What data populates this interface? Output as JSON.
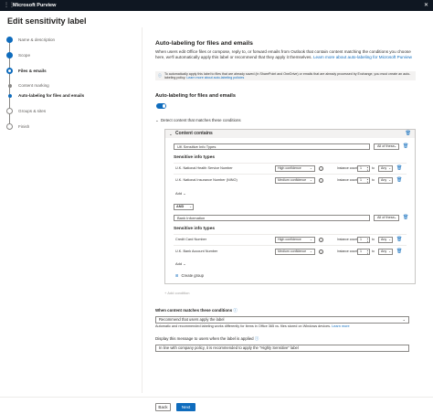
{
  "app": {
    "title": "Microsoft Purview",
    "menu_icon": "grid-dots-icon",
    "close_icon": "close-icon"
  },
  "page": {
    "title": "Edit sensitivity label"
  },
  "wizard": {
    "steps": [
      {
        "label": "Name & description",
        "state": "done"
      },
      {
        "label": "Scope",
        "state": "done"
      },
      {
        "label": "Files & emails",
        "state": "current"
      },
      {
        "label": "Content marking",
        "state": "sub"
      },
      {
        "label": "Auto-labeling for files and emails",
        "state": "sub-active"
      },
      {
        "label": "Groups & sites",
        "state": "pending"
      },
      {
        "label": "Finish",
        "state": "pending"
      }
    ]
  },
  "section": {
    "heading": "Auto-labeling for files and emails",
    "description": "When users edit Office files or compose, reply to, or forward emails from Outlook that contain content matching the conditions you choose here, we'll automatically apply this label or recommend that they apply it themselves.",
    "description_link": "Learn more about auto-labeling for Microsoft Purview",
    "info_text": "To automatically apply this label to files that are already saved (in SharePoint and OneDrive) or emails that are already processed by Exchange, you must create an auto-labeling policy.",
    "info_link": "Learn more about auto-labeling policies"
  },
  "auto_labeling": {
    "heading": "Auto-labeling for files and emails",
    "toggle_on": true,
    "detect_label": "Detect content that matches these conditions"
  },
  "content_contains": {
    "title": "Content contains",
    "groups": [
      {
        "name": "UK Sensitive Info Types",
        "match": "All of these",
        "section_title": "Sensitive info types",
        "items": [
          {
            "name": "U.K. National Health Service Number",
            "confidence": "High confidence",
            "count_label": "Instance count",
            "min": "1",
            "to": "to",
            "max": "Any"
          },
          {
            "name": "U.K. National Insurance Number (NINO)",
            "confidence": "Medium confidence",
            "count_label": "Instance count",
            "min": "1",
            "to": "to",
            "max": "Any"
          }
        ],
        "add_label": "Add"
      },
      {
        "operator": "AND",
        "name": "Bank Information",
        "match": "All of these",
        "section_title": "Sensitive info types",
        "items": [
          {
            "name": "Credit Card Number",
            "confidence": "High confidence",
            "count_label": "Instance count",
            "min": "1",
            "to": "to",
            "max": "Any"
          },
          {
            "name": "U.K. Bank Account Number",
            "confidence": "Medium confidence",
            "count_label": "Instance count",
            "min": "1",
            "to": "to",
            "max": "Any"
          }
        ],
        "add_label": "Add"
      }
    ],
    "create_group": "Create group"
  },
  "add_condition": "+ Add condition",
  "when_matches": {
    "label": "When content matches these conditions",
    "value": "Recommend that users apply the label",
    "helper": "Automatic and recommended labeling works differently for items in Office 365 vs. files stored on Windows devices.",
    "helper_link": "Learn more"
  },
  "message": {
    "label": "Display this message to users when the label is applied",
    "value": "In line with company policy, it is recommended to apply the \"Highly Sensitive\" label"
  },
  "footer": {
    "back": "Back",
    "next": "Next"
  }
}
